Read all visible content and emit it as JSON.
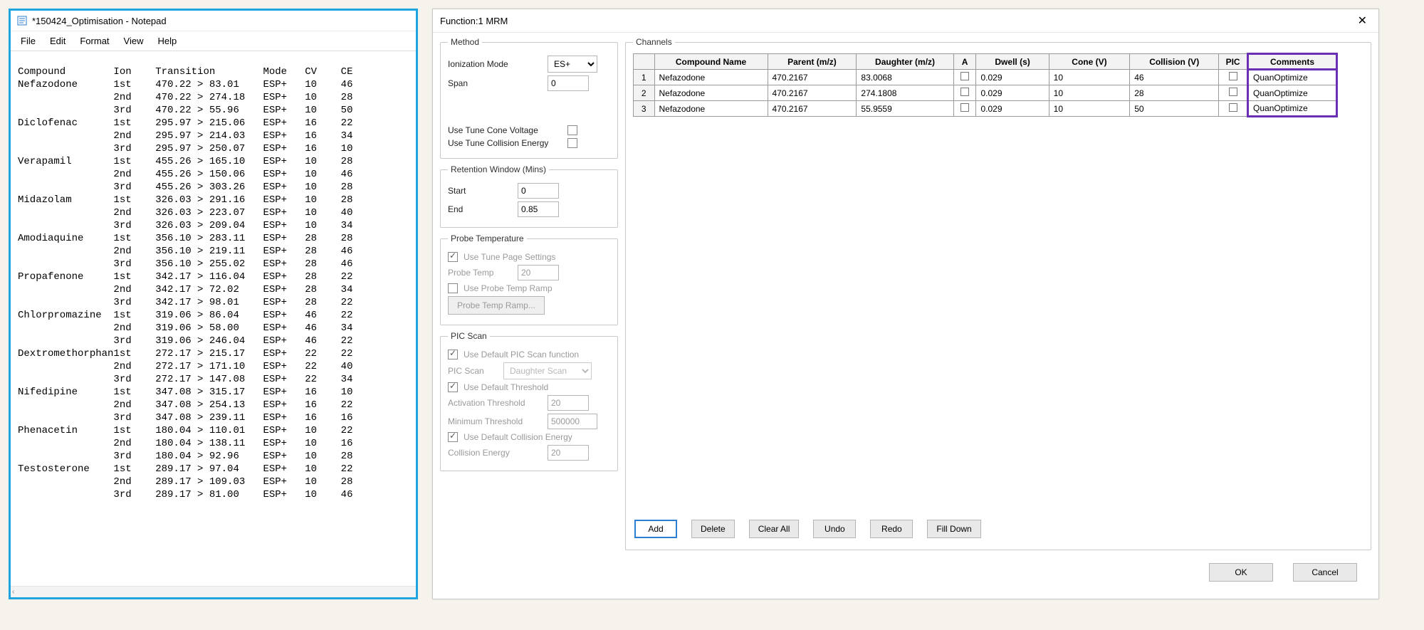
{
  "notepad": {
    "title": "*150424_Optimisation - Notepad",
    "menu": [
      "File",
      "Edit",
      "Format",
      "View",
      "Help"
    ],
    "headers": [
      "Compound",
      "Ion",
      "Transition",
      "Mode",
      "CV",
      "CE"
    ],
    "compounds": [
      {
        "name": "Nefazodone",
        "rows": [
          [
            "1st",
            "470.22 > 83.01",
            "ESP+",
            "10",
            "46"
          ],
          [
            "2nd",
            "470.22 > 274.18",
            "ESP+",
            "10",
            "28"
          ],
          [
            "3rd",
            "470.22 > 55.96",
            "ESP+",
            "10",
            "50"
          ]
        ]
      },
      {
        "name": "Diclofenac",
        "rows": [
          [
            "1st",
            "295.97 > 215.06",
            "ESP+",
            "16",
            "22"
          ],
          [
            "2nd",
            "295.97 > 214.03",
            "ESP+",
            "16",
            "34"
          ],
          [
            "3rd",
            "295.97 > 250.07",
            "ESP+",
            "16",
            "10"
          ]
        ]
      },
      {
        "name": "Verapamil",
        "rows": [
          [
            "1st",
            "455.26 > 165.10",
            "ESP+",
            "10",
            "28"
          ],
          [
            "2nd",
            "455.26 > 150.06",
            "ESP+",
            "10",
            "46"
          ],
          [
            "3rd",
            "455.26 > 303.26",
            "ESP+",
            "10",
            "28"
          ]
        ]
      },
      {
        "name": "Midazolam",
        "rows": [
          [
            "1st",
            "326.03 > 291.16",
            "ESP+",
            "10",
            "28"
          ],
          [
            "2nd",
            "326.03 > 223.07",
            "ESP+",
            "10",
            "40"
          ],
          [
            "3rd",
            "326.03 > 209.04",
            "ESP+",
            "10",
            "34"
          ]
        ]
      },
      {
        "name": "Amodiaquine",
        "rows": [
          [
            "1st",
            "356.10 > 283.11",
            "ESP+",
            "28",
            "28"
          ],
          [
            "2nd",
            "356.10 > 219.11",
            "ESP+",
            "28",
            "46"
          ],
          [
            "3rd",
            "356.10 > 255.02",
            "ESP+",
            "28",
            "46"
          ]
        ]
      },
      {
        "name": "Propafenone",
        "rows": [
          [
            "1st",
            "342.17 > 116.04",
            "ESP+",
            "28",
            "22"
          ],
          [
            "2nd",
            "342.17 > 72.02",
            "ESP+",
            "28",
            "34"
          ],
          [
            "3rd",
            "342.17 > 98.01",
            "ESP+",
            "28",
            "22"
          ]
        ]
      },
      {
        "name": "Chlorpromazine",
        "rows": [
          [
            "1st",
            "319.06 > 86.04",
            "ESP+",
            "46",
            "22"
          ],
          [
            "2nd",
            "319.06 > 58.00",
            "ESP+",
            "46",
            "34"
          ],
          [
            "3rd",
            "319.06 > 246.04",
            "ESP+",
            "46",
            "22"
          ]
        ]
      },
      {
        "name": "Dextromethorphan",
        "rows": [
          [
            "1st",
            "272.17 > 215.17",
            "ESP+",
            "22",
            "22"
          ],
          [
            "2nd",
            "272.17 > 171.10",
            "ESP+",
            "22",
            "40"
          ],
          [
            "3rd",
            "272.17 > 147.08",
            "ESP+",
            "22",
            "34"
          ]
        ]
      },
      {
        "name": "Nifedipine",
        "rows": [
          [
            "1st",
            "347.08 > 315.17",
            "ESP+",
            "16",
            "10"
          ],
          [
            "2nd",
            "347.08 > 254.13",
            "ESP+",
            "16",
            "22"
          ],
          [
            "3rd",
            "347.08 > 239.11",
            "ESP+",
            "16",
            "16"
          ]
        ]
      },
      {
        "name": "Phenacetin",
        "rows": [
          [
            "1st",
            "180.04 > 110.01",
            "ESP+",
            "10",
            "22"
          ],
          [
            "2nd",
            "180.04 > 138.11",
            "ESP+",
            "10",
            "16"
          ],
          [
            "3rd",
            "180.04 > 92.96",
            "ESP+",
            "10",
            "28"
          ]
        ]
      },
      {
        "name": "Testosterone",
        "rows": [
          [
            "1st",
            "289.17 > 97.04",
            "ESP+",
            "10",
            "22"
          ],
          [
            "2nd",
            "289.17 > 109.03",
            "ESP+",
            "10",
            "28"
          ],
          [
            "3rd",
            "289.17 > 81.00",
            "ESP+",
            "10",
            "46"
          ]
        ]
      }
    ]
  },
  "dialog": {
    "title": "Function:1 MRM",
    "method": {
      "legend": "Method",
      "ion_mode_label": "Ionization Mode",
      "ion_mode_value": "ES+",
      "span_label": "Span",
      "span_value": "0",
      "use_tune_cone_label": "Use Tune Cone Voltage",
      "use_tune_collision_label": "Use Tune Collision Energy"
    },
    "retention": {
      "legend": "Retention Window (Mins)",
      "start_label": "Start",
      "start_value": "0",
      "end_label": "End",
      "end_value": "0.85"
    },
    "probe": {
      "legend": "Probe Temperature",
      "use_tune_page_label": "Use Tune Page Settings",
      "probe_temp_label": "Probe Temp",
      "probe_temp_value": "20",
      "use_ramp_label": "Use Probe Temp Ramp",
      "ramp_button": "Probe Temp Ramp..."
    },
    "pic": {
      "legend": "PIC Scan",
      "use_default_pic_label": "Use Default PIC Scan function",
      "pic_scan_label": "PIC Scan",
      "pic_scan_value": "Daughter Scan",
      "use_default_threshold_label": "Use Default Threshold",
      "activation_threshold_label": "Activation Threshold",
      "activation_threshold_value": "20",
      "minimum_threshold_label": "Minimum Threshold",
      "minimum_threshold_value": "500000",
      "use_default_ce_label": "Use Default Collision Energy",
      "collision_energy_label": "Collision Energy",
      "collision_energy_value": "20"
    },
    "channels": {
      "legend": "Channels",
      "headers": [
        "",
        "Compound Name",
        "Parent (m/z)",
        "Daughter (m/z)",
        "A",
        "Dwell (s)",
        "Cone (V)",
        "Collision (V)",
        "PIC",
        "Comments"
      ],
      "rows": [
        {
          "idx": "1",
          "name": "Nefazodone",
          "parent": "470.2167",
          "daughter": "83.0068",
          "dwell": "0.029",
          "cone": "10",
          "collision": "46",
          "comments": "QuanOptimize"
        },
        {
          "idx": "2",
          "name": "Nefazodone",
          "parent": "470.2167",
          "daughter": "274.1808",
          "dwell": "0.029",
          "cone": "10",
          "collision": "28",
          "comments": "QuanOptimize"
        },
        {
          "idx": "3",
          "name": "Nefazodone",
          "parent": "470.2167",
          "daughter": "55.9559",
          "dwell": "0.029",
          "cone": "10",
          "collision": "50",
          "comments": "QuanOptimize"
        }
      ],
      "buttons": {
        "add": "Add",
        "delete": "Delete",
        "clear": "Clear All",
        "undo": "Undo",
        "redo": "Redo",
        "fill": "Fill Down"
      }
    },
    "footer": {
      "ok": "OK",
      "cancel": "Cancel"
    }
  }
}
